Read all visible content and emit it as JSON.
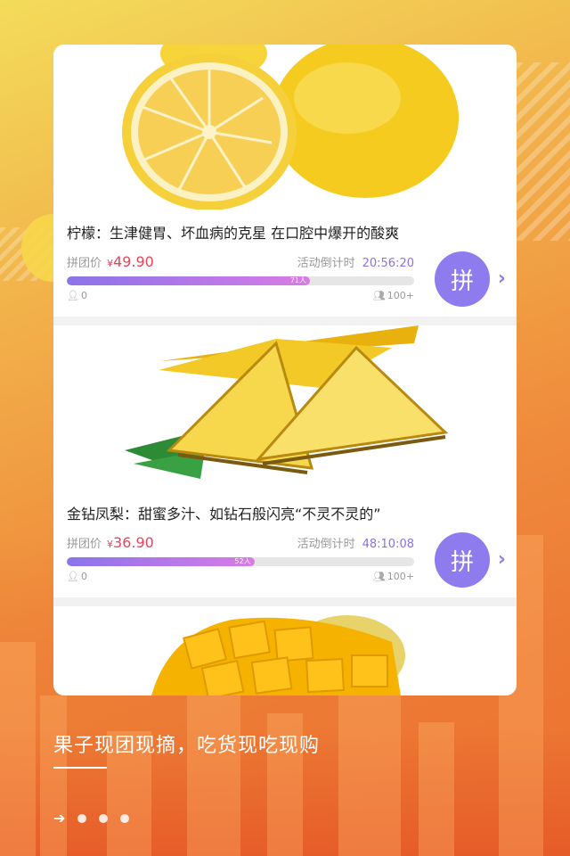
{
  "products": [
    {
      "title": "柠檬：生津健胃、坏血病的克星 在口腔中爆开的酸爽",
      "price_label": "拼团价",
      "currency": "¥",
      "price": "49.90",
      "countdown_label": "活动倒计时",
      "countdown": "20:56:20",
      "progress_label": "71人",
      "progress_fraction": 0.7,
      "min_count": "0",
      "max_count": "100+",
      "button_label": "拼",
      "image_icon": "lemon-image"
    },
    {
      "title": "金钻凤梨：甜蜜多汁、如钻石般闪亮“不灵不灵的”",
      "price_label": "拼团价",
      "currency": "¥",
      "price": "36.90",
      "countdown_label": "活动倒计时",
      "countdown": "48:10:08",
      "progress_label": "52人",
      "progress_fraction": 0.54,
      "min_count": "0",
      "max_count": "100+",
      "button_label": "拼",
      "image_icon": "pineapple-image"
    }
  ],
  "peek_item": {
    "image_icon": "mango-image"
  },
  "slogan": "果子现团现摘，吃货现吃现购",
  "pager": {
    "arrow": "➔",
    "dots": 3
  },
  "colors": {
    "accent": "#8e7bee",
    "price": "#e8445a",
    "countdown": "#8a72e6"
  }
}
